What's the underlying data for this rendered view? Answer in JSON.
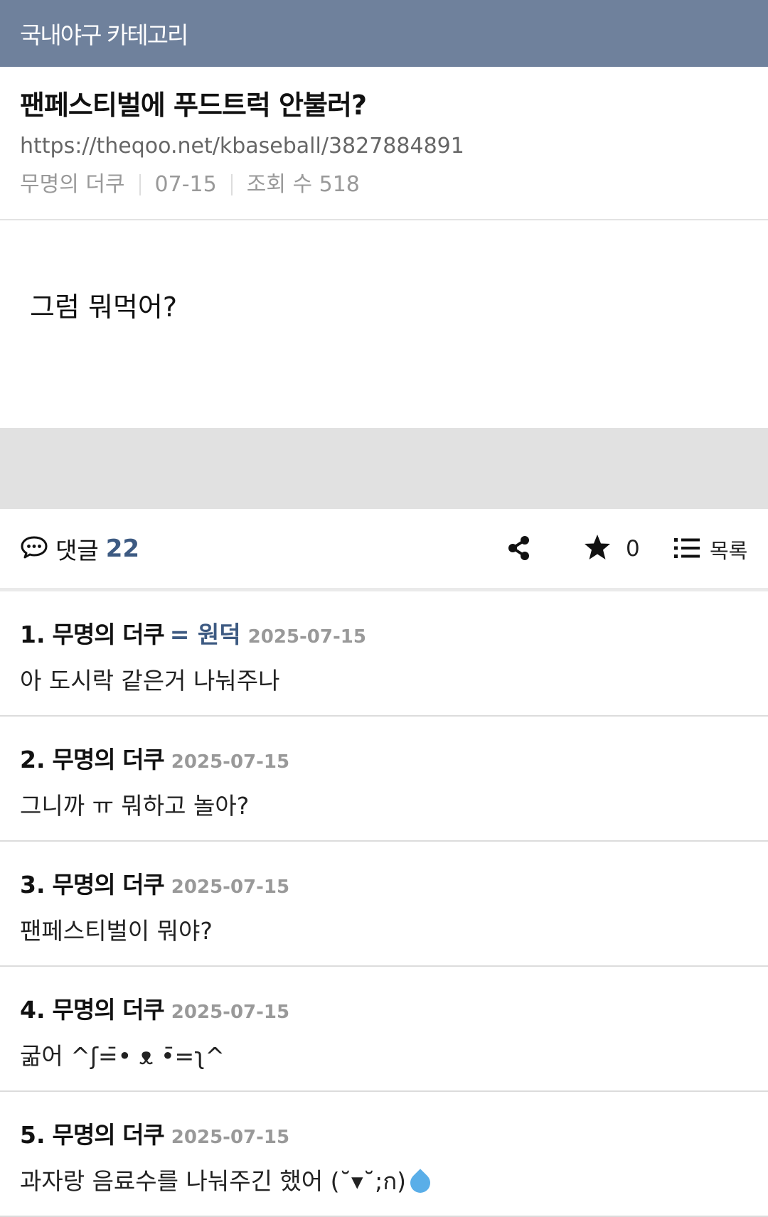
{
  "header": {
    "category": "국내야구 카테고리"
  },
  "post": {
    "title": "팬페스티벌에 푸드트럭 안불러?",
    "url": "https://theqoo.net/kbaseball/3827884891",
    "author": "무명의 더쿠",
    "date": "07-15",
    "views_label": "조회 수 518",
    "body": "그럼 뭐먹어?"
  },
  "toolbar": {
    "comments_label": "댓글",
    "comments_count": "22",
    "star_count": "0",
    "list_label": "목록",
    "icons": [
      "comment-icon",
      "share-icon",
      "star-icon",
      "list-icon"
    ]
  },
  "comments": [
    {
      "num": "1.",
      "author": "무명의 더쿠",
      "op_mark": "= 원덕",
      "date": "2025-07-15",
      "text": "아 도시락 같은거 나눠주나"
    },
    {
      "num": "2.",
      "author": "무명의 더쿠",
      "date": "2025-07-15",
      "text": "그니까 ㅠ 뭐하고 놀아?"
    },
    {
      "num": "3.",
      "author": "무명의 더쿠",
      "date": "2025-07-15",
      "text": "팬페스티벌이 뭐야?"
    },
    {
      "num": "4.",
      "author": "무명의 더쿠",
      "date": "2025-07-15",
      "text": "굶어 ^ʃ=̄• ᴥ •̄=ʅ^"
    },
    {
      "num": "5.",
      "author": "무명의 더쿠",
      "date": "2025-07-15",
      "text": "과자랑 음료수를 나눠주긴 했어 (˘▾˘;ก)"
    }
  ],
  "colors": {
    "topbar": "#6f819c",
    "accent": "#3d5a82",
    "band": "#e1e1e1"
  }
}
